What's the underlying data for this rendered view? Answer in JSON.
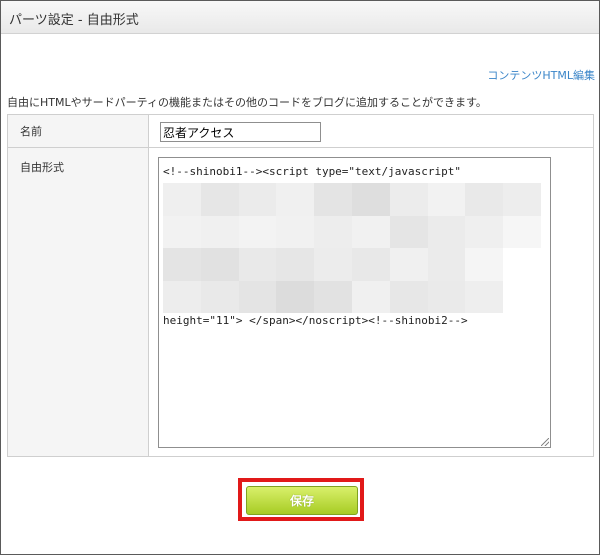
{
  "window": {
    "title": "パーツ設定 - 自由形式"
  },
  "links": {
    "edit_html": "コンテンツHTML編集"
  },
  "description": "自由にHTMLやサードパーティの機能またはその他のコードをブログに追加することができます。",
  "form": {
    "name_label": "名前",
    "name_value": "忍者アクセス",
    "code_label": "自由形式",
    "code_first_line": "<!--shinobi1--><script type=\"text/javascript\"",
    "code_last_line": "height=\"11\"> </span></noscript><!--shinobi2-->"
  },
  "buttons": {
    "save_label": "保存"
  },
  "colors": {
    "accent_link": "#3a85c8",
    "save_green": "#a7cc24",
    "highlight_red": "#e11919"
  }
}
